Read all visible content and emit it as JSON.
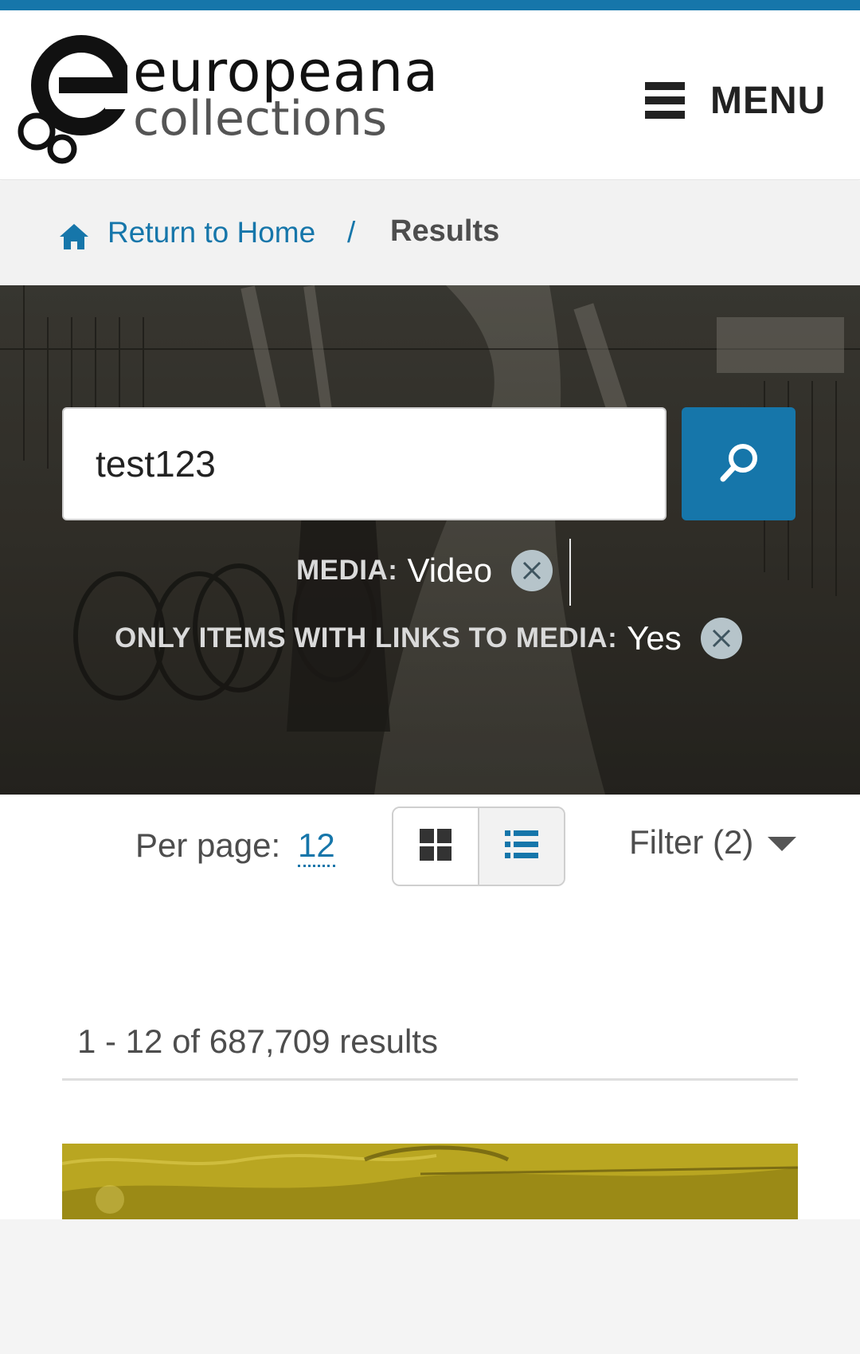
{
  "header": {
    "logo_line1": "europeana",
    "logo_line2": "collections",
    "menu_label": "MENU"
  },
  "breadcrumb": {
    "home_label": "Return to Home",
    "separator": "/",
    "current": "Results"
  },
  "search": {
    "query": "test123"
  },
  "facets": [
    {
      "name": "MEDIA:",
      "value": "Video"
    },
    {
      "name": "ONLY ITEMS WITH LINKS TO MEDIA:",
      "value": "Yes"
    }
  ],
  "toolbar": {
    "per_page_label": "Per page:",
    "per_page_value": "12",
    "filter_label": "Filter (2)"
  },
  "results": {
    "count_text": "1 - 12 of 687,709 results"
  },
  "colors": {
    "accent": "#1676aa",
    "thumbnail_tint": "#b9a621"
  },
  "icons": {
    "menu": "hamburger-icon",
    "home": "home-icon",
    "search": "magnifier-icon",
    "remove": "close-icon",
    "grid_view": "grid-icon",
    "list_view": "list-icon",
    "filter": "caret-down-icon"
  }
}
